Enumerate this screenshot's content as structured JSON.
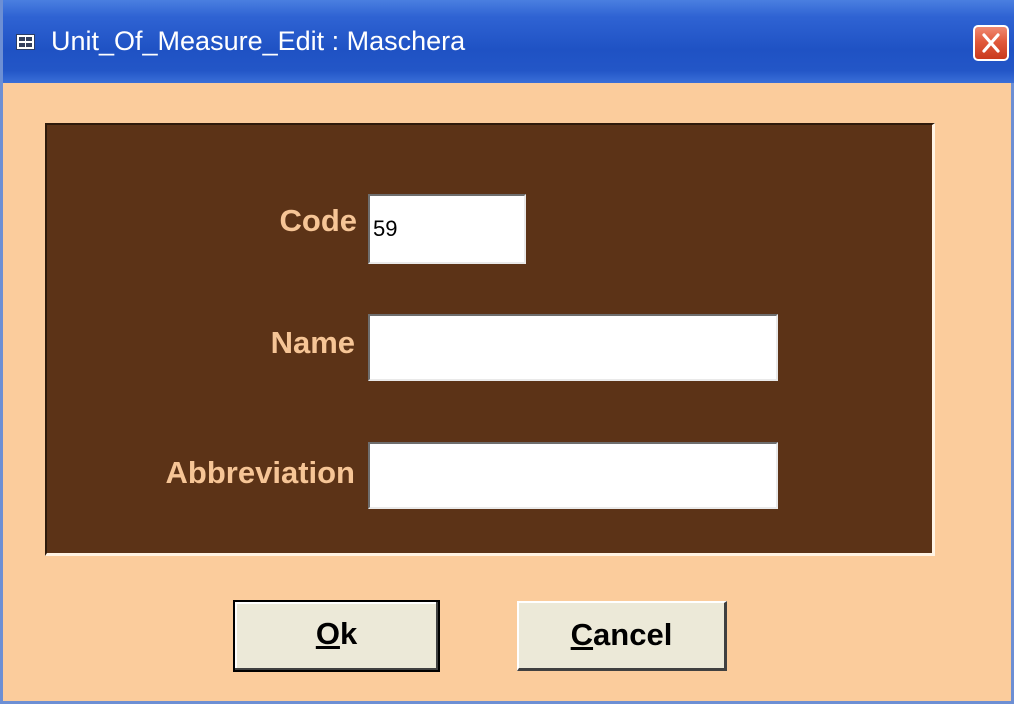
{
  "window": {
    "title": "Unit_Of_Measure_Edit : Maschera",
    "title_icon": "form-icon",
    "close_icon": "close-icon"
  },
  "form": {
    "code": {
      "label": "Code",
      "value": "59"
    },
    "name": {
      "label": "Name",
      "value": ""
    },
    "abbreviation": {
      "label": "Abbreviation",
      "value": ""
    }
  },
  "buttons": {
    "ok": {
      "mnemonic": "O",
      "rest": "k"
    },
    "cancel": {
      "mnemonic": "C",
      "rest": "ancel"
    }
  },
  "colors": {
    "window_bg": "#fbcc9c",
    "panel_bg": "#5c3317",
    "label_text": "#f6c596",
    "titlebar": "#2356c7",
    "close_button": "#e15a3c"
  }
}
